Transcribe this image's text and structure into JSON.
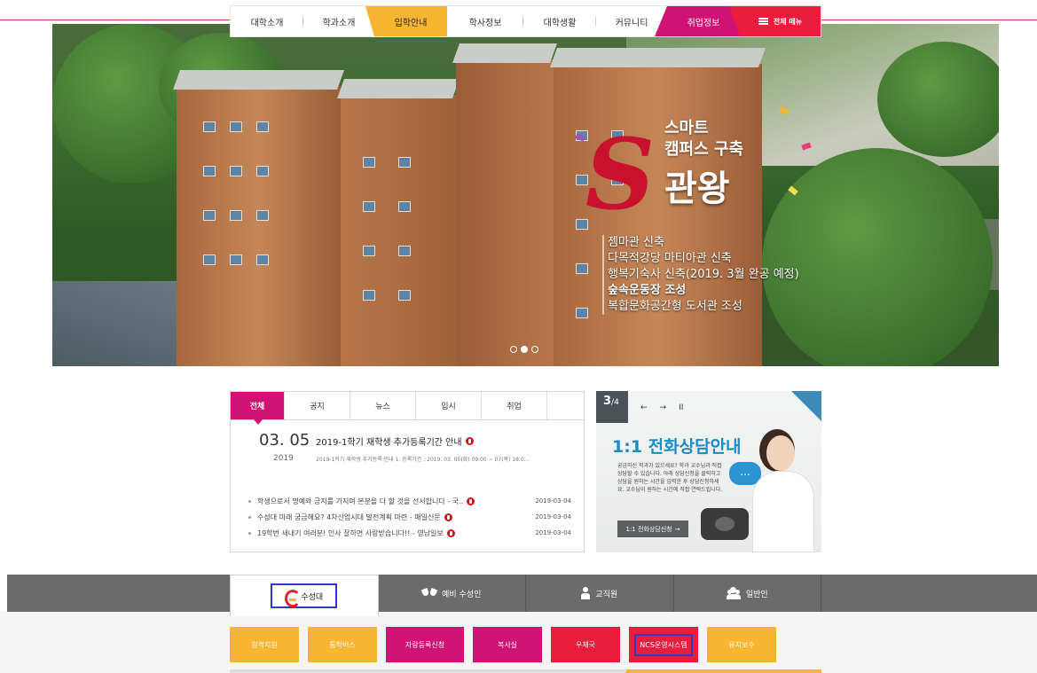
{
  "gnb": {
    "items": [
      "대학소개",
      "학과소개",
      "입학안내",
      "학사정보",
      "대학생활",
      "커뮤니티",
      "취업정보"
    ],
    "all_menu": "전체 메뉴"
  },
  "hero": {
    "slogan": [
      "스마트",
      "캠퍼스 구축",
      "관왕"
    ],
    "list": [
      "젬마관 신축",
      "다목적강당 마티아관 신축",
      "행복기숙사 신축(2019. 3월 완공 예정)",
      "숲속운동장 조성",
      "복합문화공간형 도서관 조성"
    ],
    "slides": 3,
    "active_slide": 2
  },
  "news": {
    "tabs": [
      "전체",
      "공지",
      "뉴스",
      "입시",
      "취업"
    ],
    "featured": {
      "date": "03. 05",
      "year": "2019",
      "title": "2019-1학기 재학생 추가등록기간 안내",
      "desc": "2019-1학기 재학생 추가등록 안내 1. 등록기간 : 2019. 03. 05(화) 09:00 ~ 07(목) 18:0..."
    },
    "list": [
      {
        "text": "학생으로서 명예와 긍지를 가지며 본분을 다 할 것을 선서합니다 - 국..",
        "date": "2019-03-04"
      },
      {
        "text": "수성대 미래 궁금해요? 4차산업시대 발전계획 마련 - 매일신문",
        "date": "2019-03-04"
      },
      {
        "text": "19학번 새내기 여러분! 인사 잘하면 사랑받습니다!! - 영남일보",
        "date": "2019-03-04"
      }
    ]
  },
  "banner": {
    "page_current": "3",
    "page_total": "4",
    "prev": "←",
    "next": "→",
    "pause": "II",
    "title": "1:1 전화상담안내",
    "desc": "궁금하신 학과가 있으세요? 학과 교수님과 직접 상담할 수 있습니다. 아래 상담신청을 클릭하고 상담을 원하는 시간을 입력한 후 상담신청하세요. 교수님이 원하는 시간에 직접 연락드립니다.",
    "button": "1:1 전화상담신청",
    "bubble": "..."
  },
  "quick": {
    "tabs": [
      "수성대",
      "예비 수성인",
      "교직원",
      "일반인"
    ],
    "buttons": [
      "원격지원",
      "통학버스",
      "자랑등록신청",
      "복사실",
      "우체국",
      "NCS운영시스템",
      "유지보수"
    ]
  },
  "colors": {
    "brand_pink": "#cf1273",
    "brand_orange": "#f7b531",
    "brand_red": "#ea1c3e",
    "highlight_blue": "#2d3bbf"
  }
}
